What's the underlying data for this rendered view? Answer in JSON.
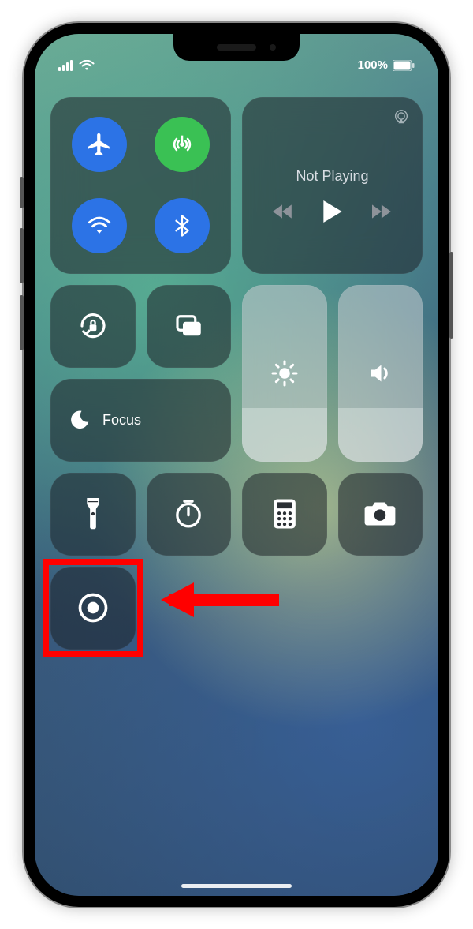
{
  "status": {
    "battery_pct": "100%"
  },
  "music": {
    "now_playing": "Not Playing"
  },
  "focus": {
    "label": "Focus"
  },
  "icons": {
    "airplane": "airplane",
    "cellular": "cellular-data",
    "wifi": "wifi",
    "bluetooth": "bluetooth",
    "airplay": "airplay",
    "prev": "previous-track",
    "play": "play",
    "next": "next-track",
    "orientation_lock": "orientation-lock",
    "screen_mirror": "screen-mirroring",
    "dnd": "do-not-disturb-moon",
    "brightness": "brightness-sun",
    "volume": "speaker",
    "flashlight": "flashlight",
    "timer": "timer",
    "calculator": "calculator",
    "camera": "camera",
    "record": "screen-record"
  },
  "annotation": {
    "arrow_direction": "left",
    "highlight_target": "screen-record-button",
    "highlight_color": "#ff0000"
  }
}
